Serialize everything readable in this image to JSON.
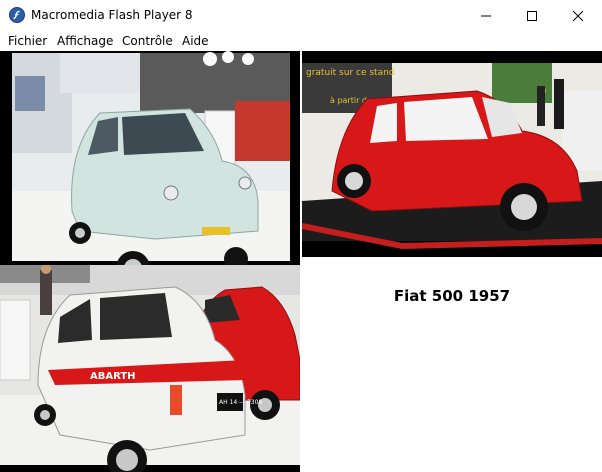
{
  "window": {
    "title": "Macromedia Flash Player 8",
    "icon": "flash-player-icon",
    "controls": [
      "minimize-icon",
      "maximize-icon",
      "close-icon"
    ]
  },
  "menu": {
    "items": [
      {
        "label": "Fichier"
      },
      {
        "label": "Affichage"
      },
      {
        "label": "Contrôle"
      },
      {
        "label": "Aide"
      }
    ]
  },
  "content": {
    "caption": "Fiat 500 1957",
    "photos": [
      {
        "description": "pale blue Fiat 500 at exhibition"
      },
      {
        "description": "red Fiat 500 on display stand"
      },
      {
        "description": "white and red Fiat Abarth rear view with red Fiat 500"
      }
    ],
    "banner_text": "gratuit sur ce stand",
    "banner_subtext": "à partir d",
    "plate_text": "AH 14 — 7308",
    "abarth_text": "ABARTH"
  },
  "colors": {
    "stage_background": "#ffffff",
    "photo_border": "#000000",
    "car_red": "#d81818",
    "car_pale_blue": "#cfe2de"
  }
}
